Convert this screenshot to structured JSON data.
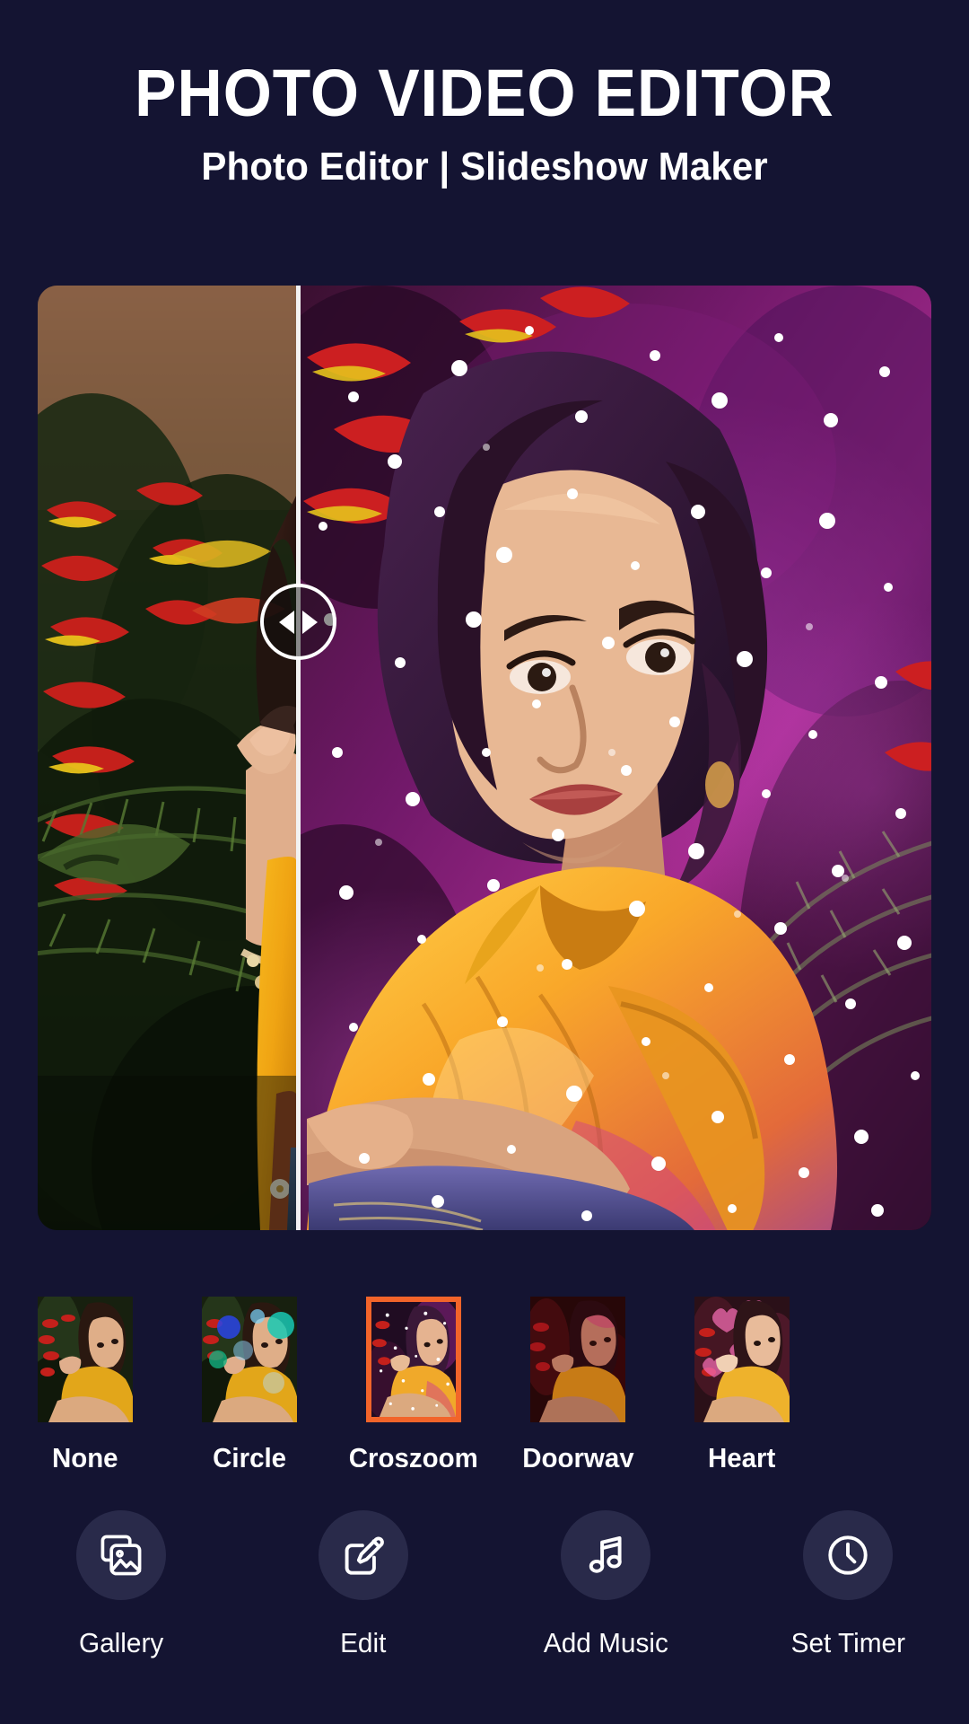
{
  "header": {
    "title": "PHOTO VIDEO EDITOR",
    "subtitle": "Photo Editor | Slideshow Maker"
  },
  "preview": {
    "name": "before-after-compare",
    "left_label": "original",
    "right_label": "filtered",
    "divider_x_percent": 29,
    "handle_icon_left": "triangle-left-icon",
    "handle_icon_right": "triangle-right-icon"
  },
  "filters": {
    "selected": "Croszoom",
    "selected_border_color": "#F2642A",
    "items": [
      {
        "label": "None",
        "selected": false
      },
      {
        "label": "Circle",
        "selected": false
      },
      {
        "label": "Croszoom",
        "selected": true
      },
      {
        "label": "Doorway",
        "selected": false
      },
      {
        "label": "Heart",
        "selected": false
      }
    ]
  },
  "toolbar": {
    "items": [
      {
        "label": "Gallery",
        "icon": "gallery-icon"
      },
      {
        "label": "Edit",
        "icon": "edit-pencil-icon"
      },
      {
        "label": "Add Music",
        "icon": "music-note-icon"
      },
      {
        "label": "Set Timer",
        "icon": "clock-icon"
      }
    ]
  },
  "colors": {
    "background": "#141432",
    "accent": "#F2642A",
    "circle": "#292A4A",
    "text": "#FFFFFF"
  }
}
